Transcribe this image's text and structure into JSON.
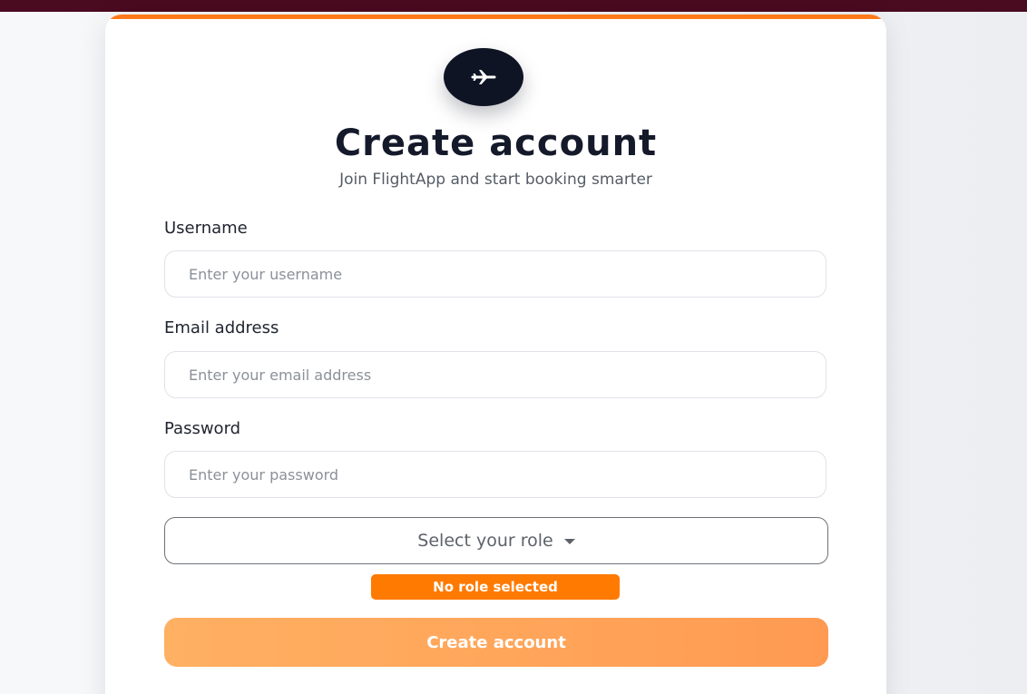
{
  "header": {
    "title": "Create account",
    "subtitle": "Join FlightApp and start booking smarter",
    "logo_icon": "airplane-icon"
  },
  "form": {
    "username": {
      "label": "Username",
      "value": "",
      "placeholder": "Enter your username"
    },
    "email": {
      "label": "Email address",
      "value": "",
      "placeholder": "Enter your email address"
    },
    "password": {
      "label": "Password",
      "value": "",
      "placeholder": "Enter your password"
    },
    "role": {
      "selected_label": "Select your role",
      "status_badge": "No role selected"
    },
    "submit_label": "Create account"
  },
  "colors": {
    "top_bar": "#4a0a1f",
    "accent": "#ff7a1a",
    "logo_bg": "#0f1425",
    "badge": "#ff7a00",
    "button_start": "#ffb062",
    "button_end": "#ff9a52"
  }
}
